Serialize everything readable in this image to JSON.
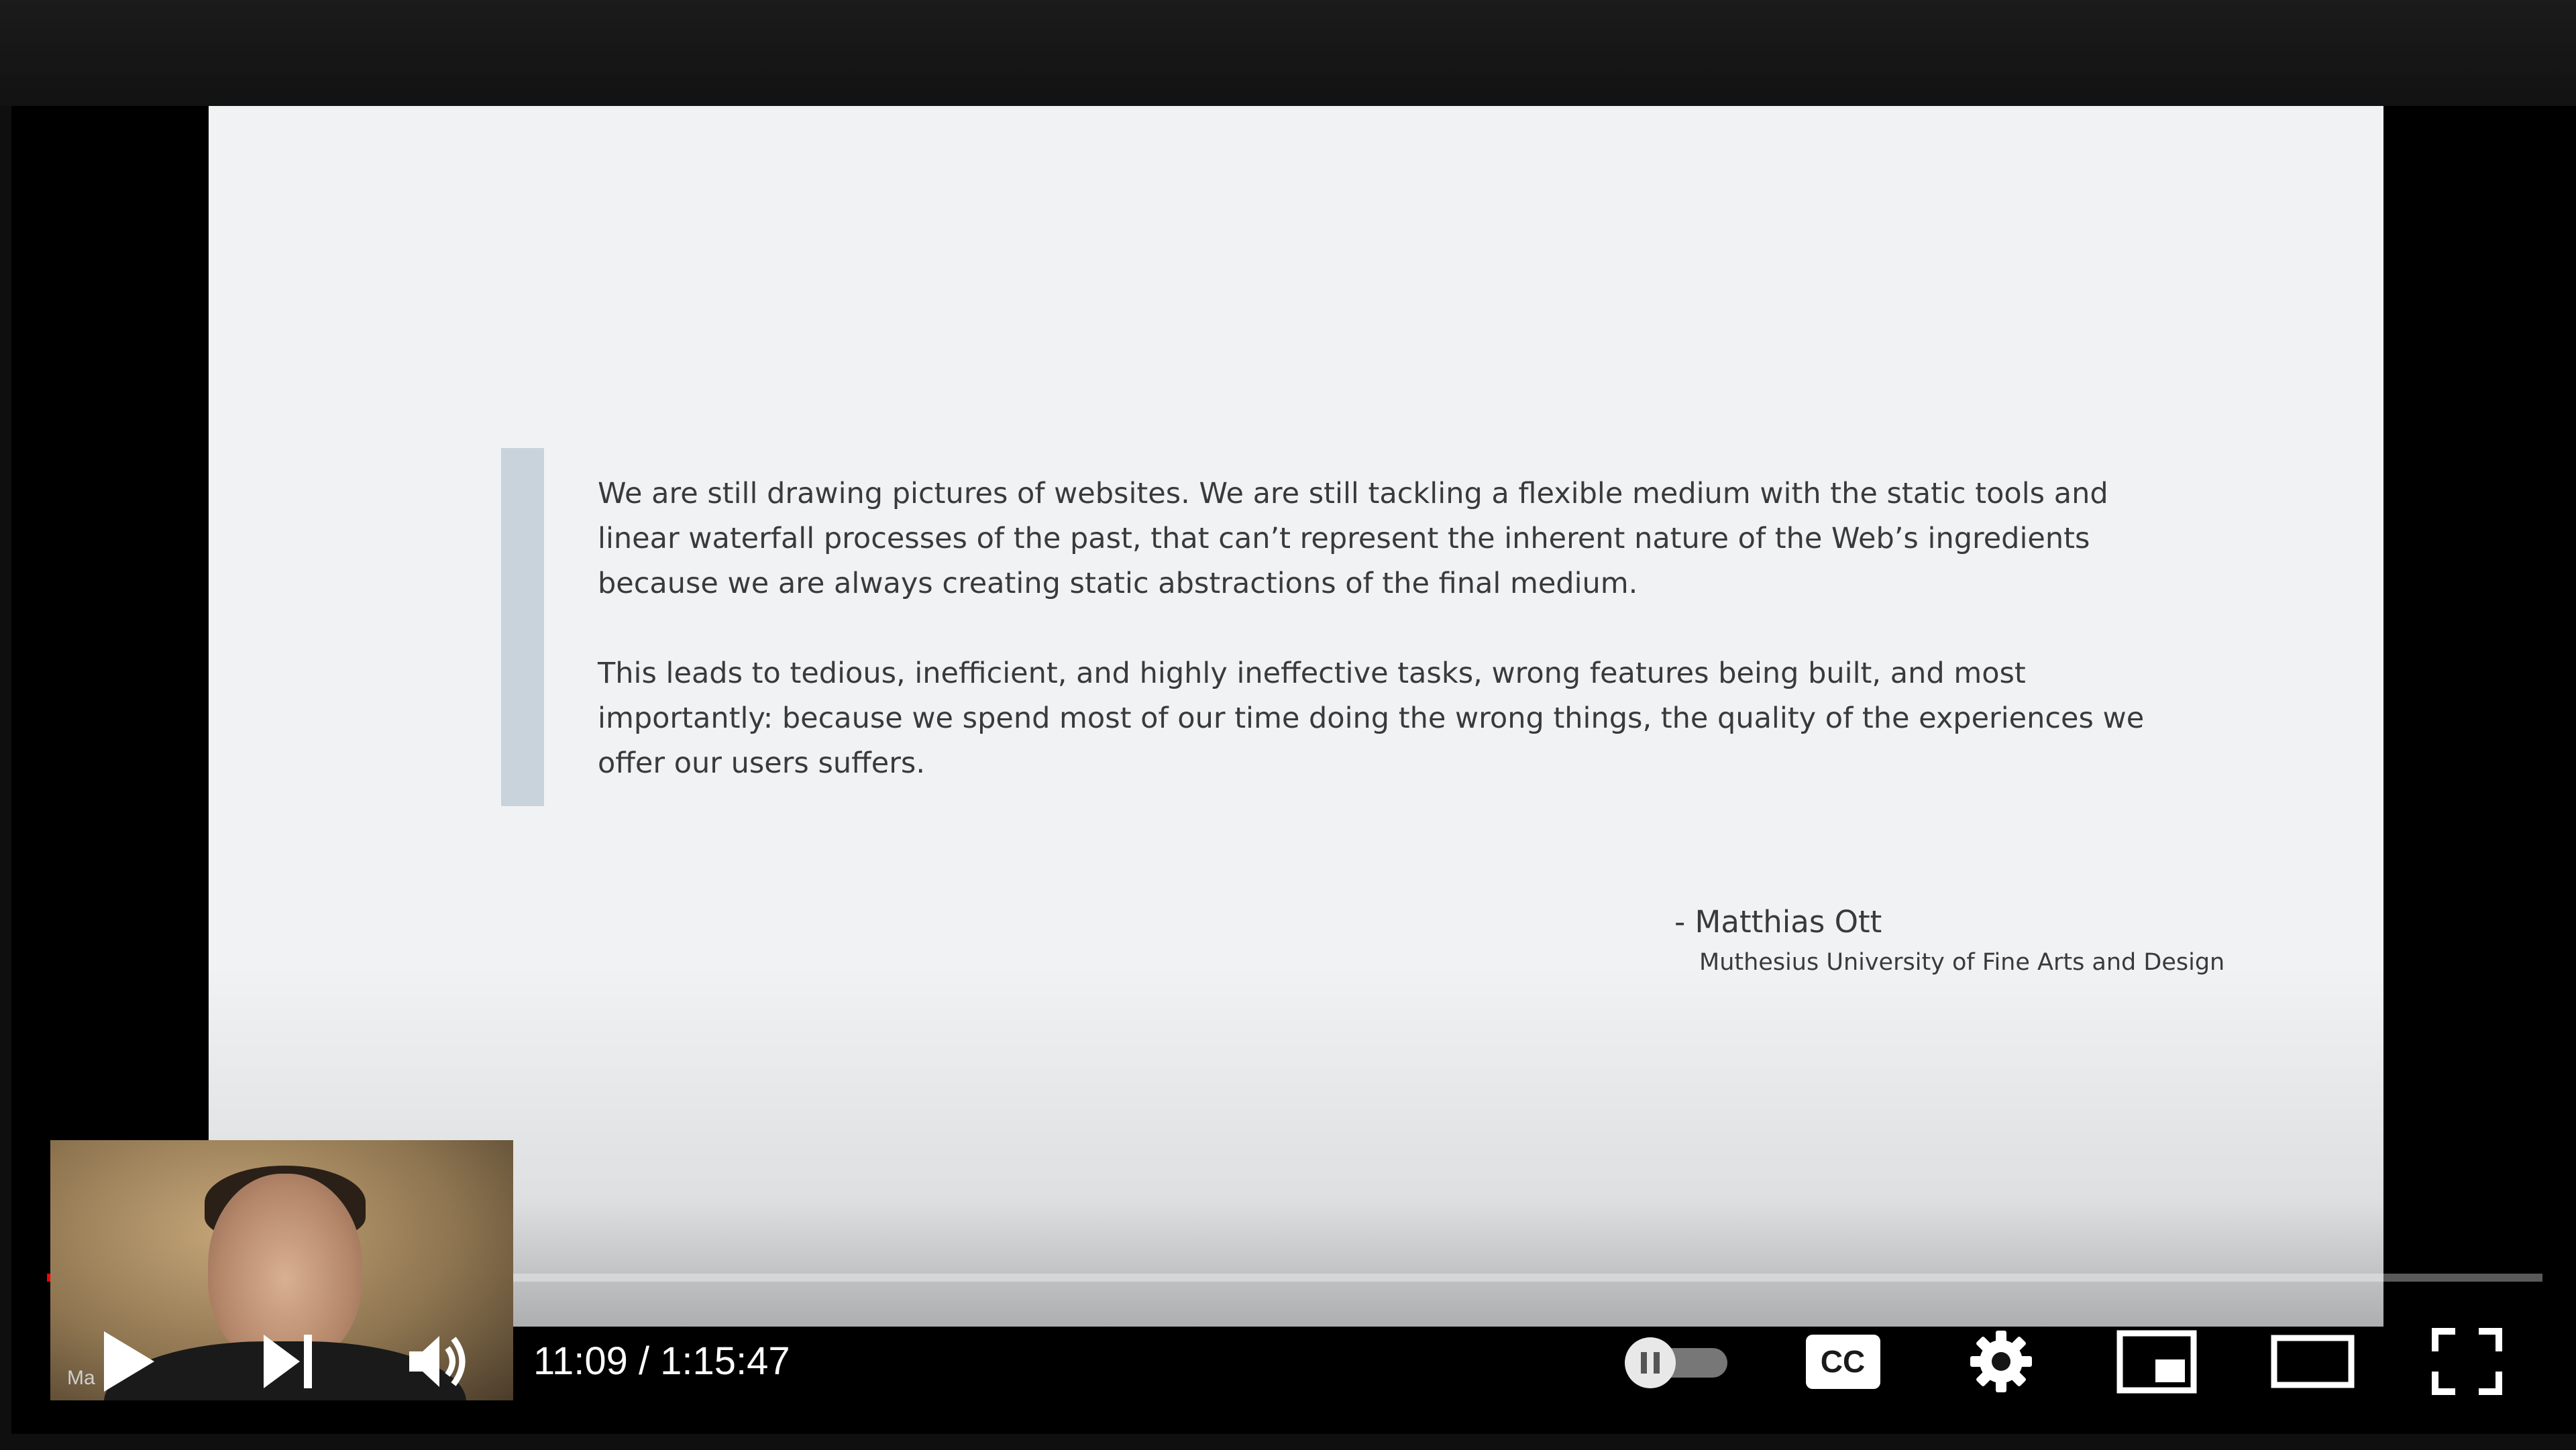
{
  "slide": {
    "paragraphs": [
      "We are still drawing pictures of websites. We are still tackling a flexible medium with the static tools and linear waterfall processes of the past, that can’t represent the inherent nature of the Web’s ingredients because we are always creating static abstractions of the final medium.",
      "This leads to tedious, inefficient, and highly ineffective tasks, wrong features being built, and most importantly: because we spend most of our time doing the wrong things, the quality of the experiences we offer our users suffers."
    ],
    "author": "- Matthias Ott",
    "affiliation": "Muthesius University of Fine Arts and Design"
  },
  "preview": {
    "tag": "Ma"
  },
  "player": {
    "current_time": "11:09",
    "duration": "1:15:47",
    "time_display": "11:09 / 1:15:47",
    "progress_fraction": 0.147,
    "accent_color": "#ff0000",
    "icons": {
      "play": "play-icon",
      "next": "next-icon",
      "volume": "volume-icon",
      "autoplay": "autoplay-toggle",
      "captions": "cc-icon",
      "settings": "gear-icon",
      "miniplayer": "miniplayer-icon",
      "theater": "theater-icon",
      "fullscreen": "fullscreen-icon"
    }
  }
}
